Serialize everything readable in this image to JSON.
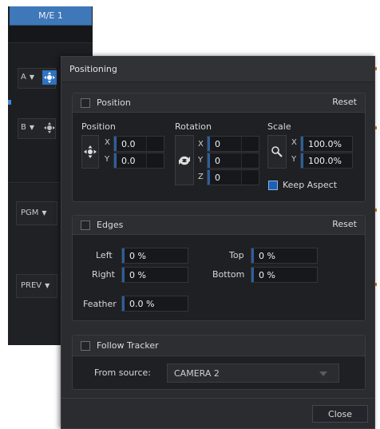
{
  "me_panel": {
    "tab_label": "M/E 1",
    "row_a_label": "A",
    "row_b_label": "B",
    "pgm_label": "PGM",
    "prev_label": "PREV"
  },
  "dialog": {
    "title": "Positioning",
    "position_section": {
      "title": "Position",
      "reset_label": "Reset",
      "position_label": "Position",
      "rotation_label": "Rotation",
      "scale_label": "Scale",
      "axes": {
        "x": "X",
        "y": "Y",
        "z": "Z"
      },
      "position_x": "0.0",
      "position_y": "0.0",
      "rotation_x": "0",
      "rotation_y": "0",
      "rotation_z": "0",
      "scale_x": "100.0%",
      "scale_y": "100.0%",
      "keep_aspect_label": "Keep Aspect",
      "keep_aspect_checked": true
    },
    "edges_section": {
      "title": "Edges",
      "reset_label": "Reset",
      "left_label": "Left",
      "left_value": "0 %",
      "right_label": "Right",
      "right_value": "0 %",
      "top_label": "Top",
      "top_value": "0 %",
      "bottom_label": "Bottom",
      "bottom_value": "0 %",
      "feather_label": "Feather",
      "feather_value": "0.0 %"
    },
    "tracker_section": {
      "title": "Follow Tracker",
      "from_source_label": "From source:",
      "source_value": "CAMERA 2"
    },
    "close_label": "Close"
  },
  "colors": {
    "accent": "#2f73c2",
    "panel_bg": "#2b2c30",
    "section_bg": "#1f2023",
    "field_bar": "#2e5f9a"
  }
}
